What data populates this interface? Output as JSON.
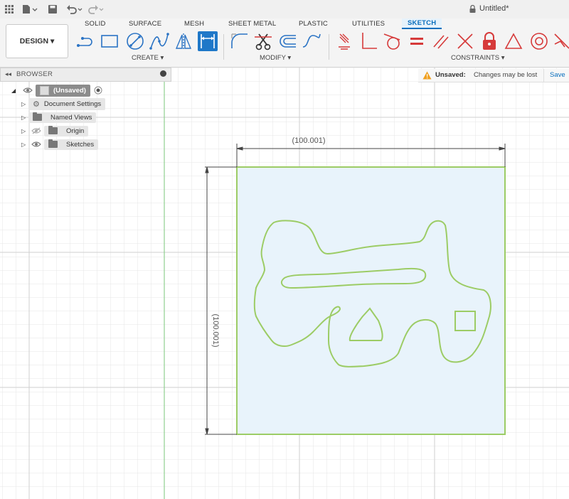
{
  "app": {
    "document_title": "Untitled*",
    "menu_icons": [
      "apps-grid-icon",
      "file-icon",
      "save-icon",
      "undo-icon",
      "redo-icon"
    ]
  },
  "ribbon": {
    "workspace_button": "DESIGN ▾",
    "tabs": [
      "SOLID",
      "SURFACE",
      "MESH",
      "SHEET METAL",
      "PLASTIC",
      "UTILITIES",
      "SKETCH"
    ],
    "active_tab": "SKETCH",
    "groups": {
      "create": "CREATE ▾",
      "modify": "MODIFY ▾",
      "constraints": "CONSTRAINTS ▾"
    },
    "accent_color": "#0a6fbd",
    "constraint_color": "#d63a3a"
  },
  "browser": {
    "title": "BROWSER",
    "root_label": "(Unsaved)",
    "items": [
      {
        "label": "Document Settings"
      },
      {
        "label": "Named Views"
      },
      {
        "label": "Origin"
      },
      {
        "label": "Sketches"
      }
    ]
  },
  "banner": {
    "label": "Unsaved:",
    "message": "Changes may be lost",
    "save_label": "Save"
  },
  "sketch": {
    "dim_horizontal": "(100.001)",
    "dim_vertical": "(100.001)",
    "profile_color": "#9ccc65",
    "fill_color": "#e8f3fb"
  }
}
